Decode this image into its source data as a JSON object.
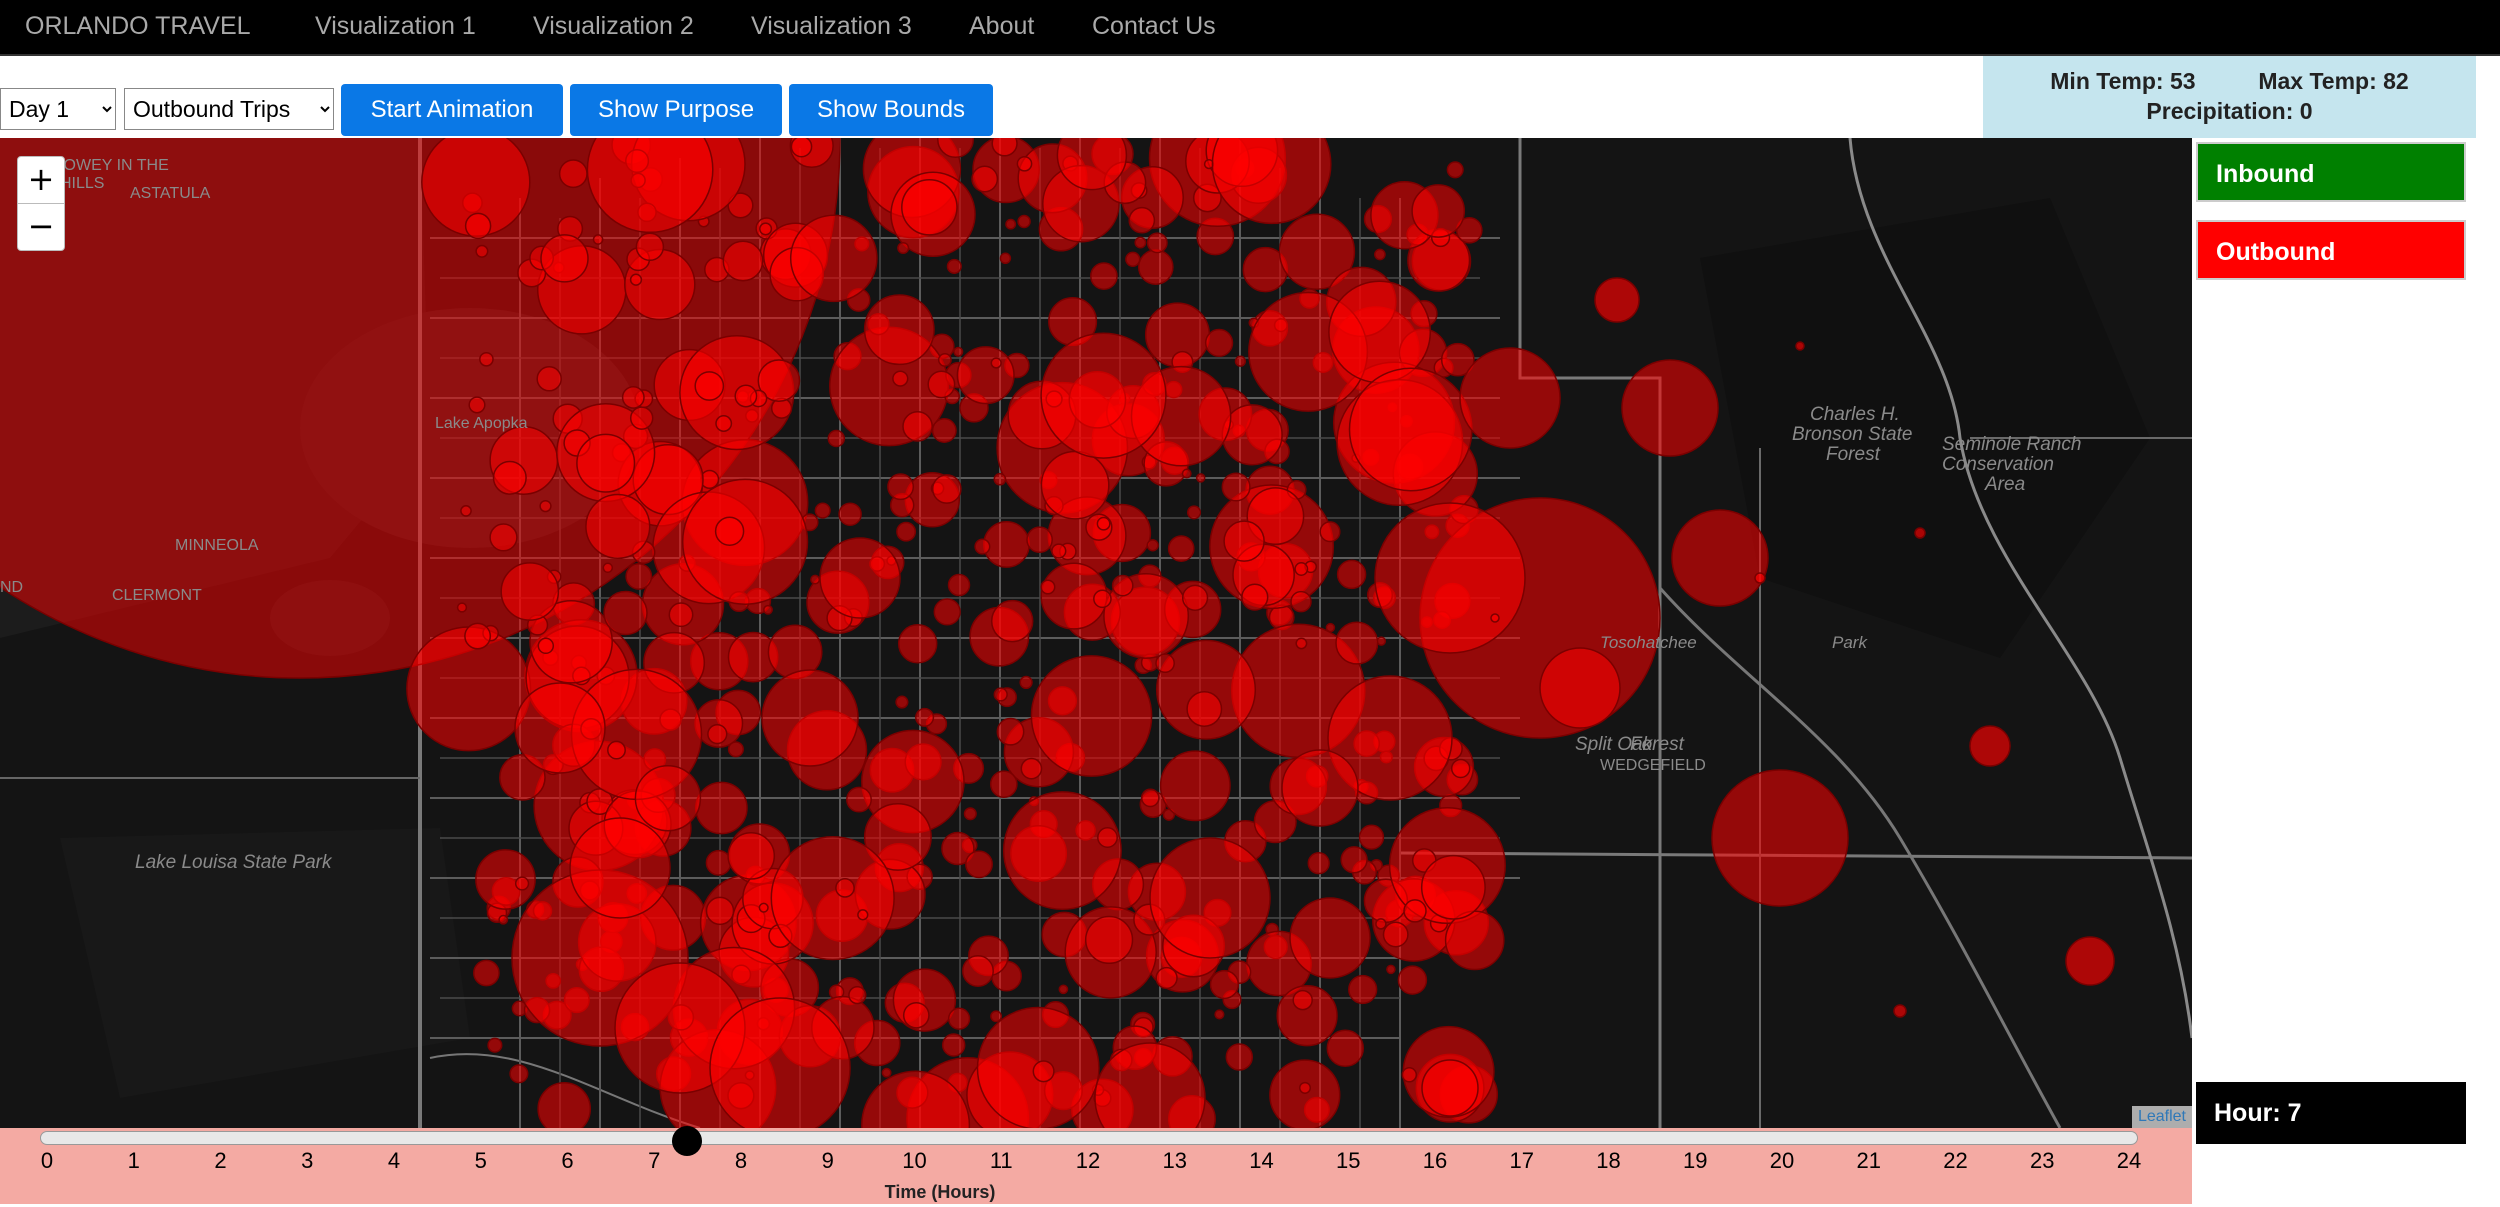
{
  "nav": {
    "brand": "ORLANDO TRAVEL",
    "links": [
      "Visualization 1",
      "Visualization 2",
      "Visualization 3",
      "About",
      "Contact Us"
    ]
  },
  "controls": {
    "day_select": "Day 1",
    "trip_select": "Outbound Trips",
    "start_animation": "Start Animation",
    "show_purpose": "Show Purpose",
    "show_bounds": "Show Bounds"
  },
  "weather": {
    "min_temp": "Min Temp: 53",
    "max_temp": "Max Temp: 82",
    "precipitation": "Precipitation: 0"
  },
  "map": {
    "zoom_in": "+",
    "zoom_out": "−",
    "attribution": "Leaflet",
    "place_labels": [
      "HOWEY IN THE",
      "HILLS",
      "ASTATULA",
      "Lake Apopka",
      "MINNEOLA",
      "CLERMONT",
      "ND",
      "Lake Louisa State Park",
      "Charles H.",
      "Bronson State",
      "Forest",
      "Seminole Ranch",
      "Conservation",
      "Area",
      "Split Oak",
      "Forest",
      "WEDGEFIELD",
      "Tosohatchee",
      "Park"
    ],
    "background_color": "#141414",
    "circle_color": "#ff0000"
  },
  "legend": {
    "inbound": "Inbound",
    "outbound": "Outbound",
    "inbound_color": "#008000",
    "outbound_color": "#ff0000"
  },
  "hour_label": "Hour: 7",
  "slider": {
    "ticks": [
      "0",
      "1",
      "2",
      "3",
      "4",
      "5",
      "6",
      "7",
      "8",
      "9",
      "10",
      "11",
      "12",
      "13",
      "14",
      "15",
      "16",
      "17",
      "18",
      "19",
      "20",
      "21",
      "22",
      "23",
      "24"
    ],
    "value": 7.4,
    "min": 0,
    "max": 24,
    "title": "Time (Hours)"
  }
}
